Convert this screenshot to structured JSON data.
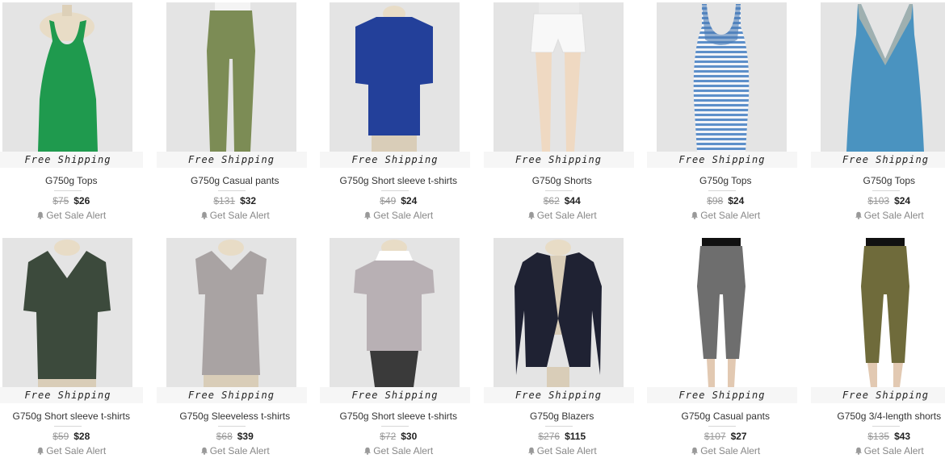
{
  "shipping_label": "Free Shipping",
  "alert_label": "Get Sale Alert",
  "products": [
    {
      "name": "G750g Tops",
      "old_price": "$75",
      "price": "$26",
      "icon": "green-tank-top-image",
      "color": "#1f9a4e"
    },
    {
      "name": "G750g Casual pants",
      "old_price": "$131",
      "price": "$32",
      "icon": "olive-pants-image",
      "color": "#7c8c55"
    },
    {
      "name": "G750g Short sleeve t-shirts",
      "old_price": "$49",
      "price": "$24",
      "icon": "blue-tshirt-image",
      "color": "#23409a"
    },
    {
      "name": "G750g Shorts",
      "old_price": "$62",
      "price": "$44",
      "icon": "white-shorts-image",
      "color": "#f4f4f4"
    },
    {
      "name": "G750g Tops",
      "old_price": "$98",
      "price": "$24",
      "icon": "striped-tank-top-image",
      "color": "#5d8fc9"
    },
    {
      "name": "G750g Tops",
      "old_price": "$103",
      "price": "$24",
      "icon": "blue-camisole-image",
      "color": "#4a93c0"
    },
    {
      "name": "G750g Short sleeve t-shirts",
      "old_price": "$59",
      "price": "$28",
      "icon": "dark-green-tshirt-image",
      "color": "#3c4a3c"
    },
    {
      "name": "G750g Sleeveless t-shirts",
      "old_price": "$68",
      "price": "$39",
      "icon": "grey-top-image",
      "color": "#a9a3a3"
    },
    {
      "name": "G750g Short sleeve t-shirts",
      "old_price": "$72",
      "price": "$30",
      "icon": "lilac-tshirt-image",
      "color": "#b8b0b4"
    },
    {
      "name": "G750g Blazers",
      "old_price": "$276",
      "price": "$115",
      "icon": "navy-blazer-image",
      "color": "#1f2233"
    },
    {
      "name": "G750g Casual pants",
      "old_price": "$107",
      "price": "$27",
      "icon": "grey-cropped-pants-image",
      "color": "#6e6e6e"
    },
    {
      "name": "G750g 3/4-length shorts",
      "old_price": "$135",
      "price": "$43",
      "icon": "olive-cropped-pants-image",
      "color": "#6f6b3b"
    }
  ]
}
